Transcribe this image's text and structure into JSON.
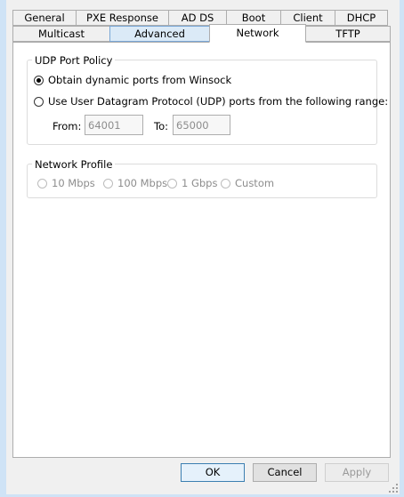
{
  "tabs_row1": [
    {
      "label": "General"
    },
    {
      "label": "PXE Response"
    },
    {
      "label": "AD DS"
    },
    {
      "label": "Boot"
    },
    {
      "label": "Client"
    },
    {
      "label": "DHCP"
    }
  ],
  "tabs_row2": [
    {
      "label": "Multicast"
    },
    {
      "label": "Advanced"
    },
    {
      "label": "Network"
    },
    {
      "label": "TFTP"
    }
  ],
  "udp_group": {
    "title": "UDP Port Policy",
    "option_dynamic": "Obtain dynamic ports from Winsock",
    "option_range": "Use User Datagram Protocol (UDP) ports from the following range:",
    "selected": "option_dynamic",
    "from_label": "From:",
    "from_value": "64001",
    "to_label": "To:",
    "to_value": "65000"
  },
  "network_group": {
    "title": "Network Profile",
    "options": [
      "10 Mbps",
      "100 Mbps",
      "1 Gbps",
      "Custom"
    ]
  },
  "buttons": {
    "ok": "OK",
    "cancel": "Cancel",
    "apply": "Apply"
  }
}
